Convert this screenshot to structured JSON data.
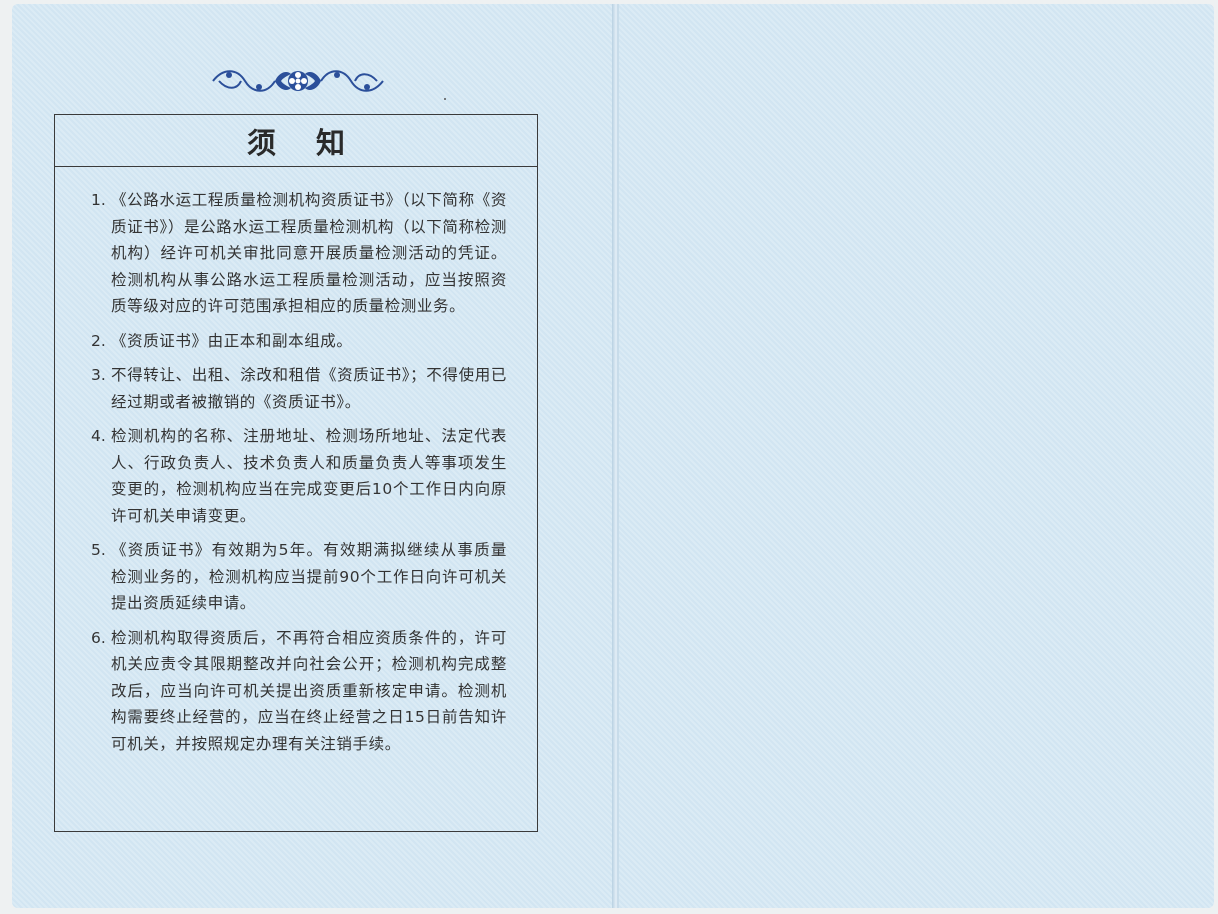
{
  "notice": {
    "title": "须知",
    "items": [
      {
        "num": "1.",
        "text": "《公路水运工程质量检测机构资质证书》（以下简称《资质证书》）是公路水运工程质量检测机构（以下简称检测机构）经许可机关审批同意开展质量检测活动的凭证。检测机构从事公路水运工程质量检测活动，应当按照资质等级对应的许可范围承担相应的质量检测业务。"
      },
      {
        "num": "2.",
        "text": "《资质证书》由正本和副本组成。"
      },
      {
        "num": "3.",
        "text": "不得转让、出租、涂改和租借《资质证书》；不得使用已经过期或者被撤销的《资质证书》。"
      },
      {
        "num": "4.",
        "text": "检测机构的名称、注册地址、检测场所地址、法定代表人、行政负责人、技术负责人和质量负责人等事项发生变更的，检测机构应当在完成变更后10个工作日内向原许可机关申请变更。"
      },
      {
        "num": "5.",
        "text": "《资质证书》有效期为5年。有效期满拟继续从事质量检测业务的，检测机构应当提前90个工作日向许可机关提出资质延续申请。"
      },
      {
        "num": "6.",
        "text": "检测机构取得资质后，不再符合相应资质条件的，许可机关应责令其限期整改并向社会公开；检测机构完成整改后，应当向许可机关提出资质重新核定申请。检测机构需要终止经营的，应当在终止经营之日15日前告知许可机关，并按照规定办理有关注销手续。"
      }
    ]
  },
  "colors": {
    "page": "#d7e9f4",
    "ink": "#333333",
    "ornament": "#2b4f9a"
  },
  "icons": {
    "ornament": "floral-ornament-icon"
  }
}
